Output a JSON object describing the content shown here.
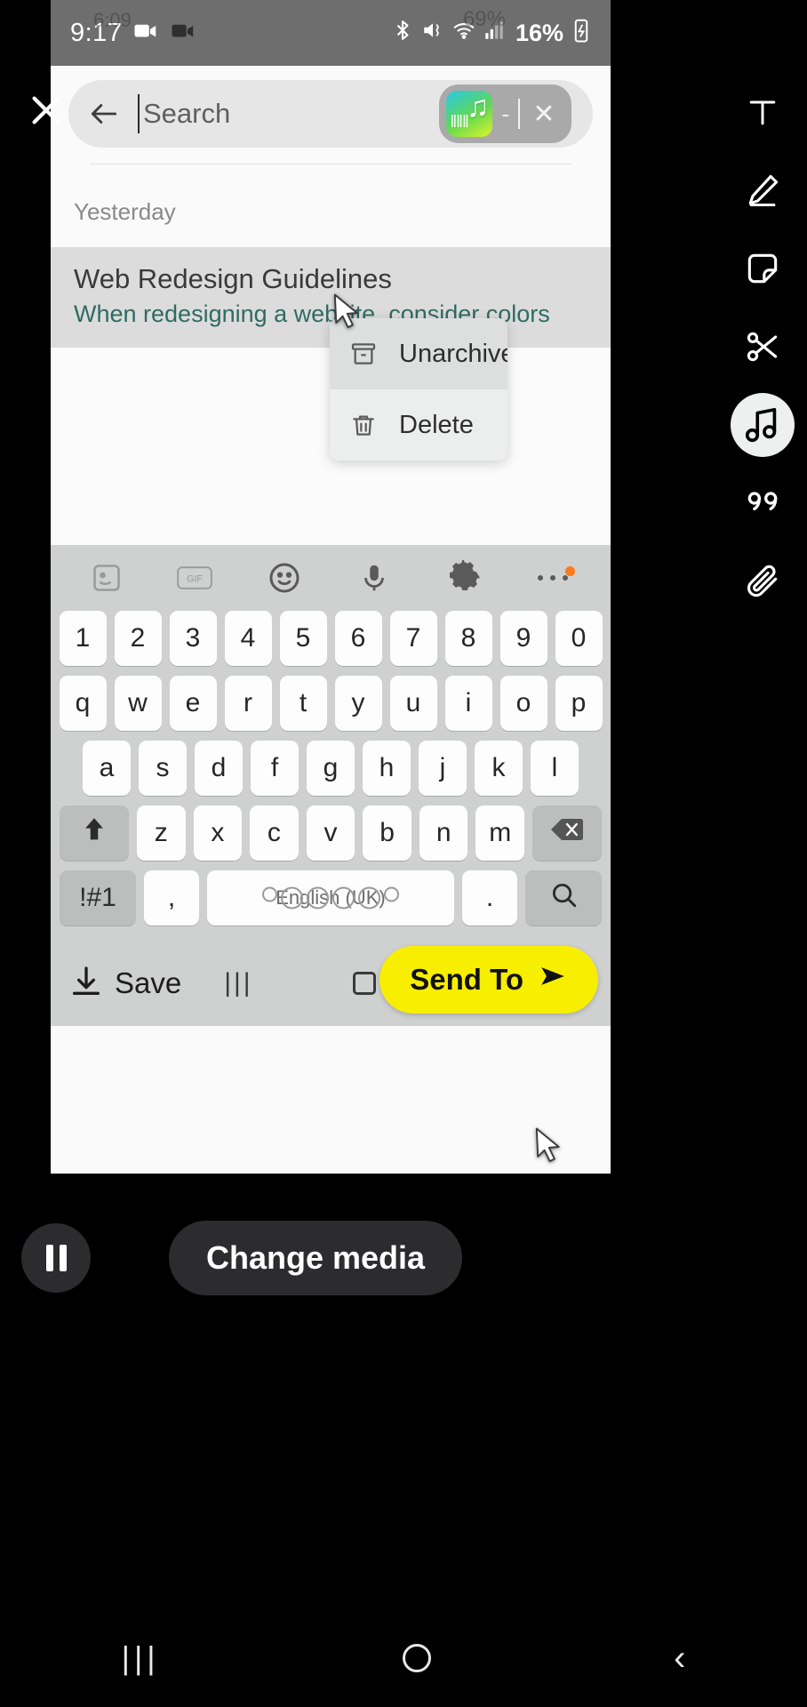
{
  "status_bar": {
    "time": "9:17",
    "left_icons": [
      "camera-icon",
      "video-camera-icon"
    ],
    "right_icons": [
      "bluetooth-icon",
      "mute-vibrate-icon",
      "wifi-icon",
      "cellular-signal-icon"
    ],
    "battery_percent": "16%",
    "battery_icon": "battery-charging-icon",
    "ghost_time": "6:09",
    "ghost_battery": "69%"
  },
  "search": {
    "back_icon": "back-arrow-icon",
    "placeholder": "Search",
    "value": "",
    "chip": {
      "app_icon": "music-app-icon",
      "note_glyph": "♫",
      "wave_glyph": "‖‖‖",
      "dash": "-",
      "close_icon": "close-icon"
    }
  },
  "list": {
    "section_label": "Yesterday",
    "items": [
      {
        "title": "Web Redesign Guidelines",
        "subtitle": "When redesigning a website, consider colors"
      }
    ]
  },
  "context_menu": {
    "items": [
      {
        "label": "Unarchive",
        "icon": "archive-box-icon",
        "highlighted": true
      },
      {
        "label": "Delete",
        "icon": "trash-icon",
        "highlighted": false
      }
    ]
  },
  "tool_rail": {
    "close_icon": "close-icon",
    "items": [
      {
        "name": "text-tool",
        "icon": "text-T-icon",
        "active": false
      },
      {
        "name": "draw-tool",
        "icon": "pen-icon",
        "active": false
      },
      {
        "name": "sticker-tool",
        "icon": "sticker-icon",
        "active": false
      },
      {
        "name": "trim-tool",
        "icon": "scissors-icon",
        "active": false
      },
      {
        "name": "music-tool",
        "icon": "music-note-icon",
        "active": true
      },
      {
        "name": "quote-tool",
        "icon": "quote-icon",
        "active": false
      },
      {
        "name": "attach-tool",
        "icon": "paperclip-icon",
        "active": false
      }
    ]
  },
  "keyboard": {
    "toolbar": [
      {
        "name": "sticker-suggest",
        "icon": "sticker-square-icon",
        "dim": true
      },
      {
        "name": "gif-key",
        "icon": "gif-icon",
        "dim": true
      },
      {
        "name": "emoji-key",
        "icon": "emoji-smiley-icon",
        "dim": false
      },
      {
        "name": "voice-key",
        "icon": "microphone-icon",
        "dim": false
      },
      {
        "name": "settings-key",
        "icon": "gear-icon",
        "dim": false
      },
      {
        "name": "more-key",
        "icon": "overflow-dots-icon",
        "dim": false,
        "badge": true
      }
    ],
    "row_numbers": [
      "1",
      "2",
      "3",
      "4",
      "5",
      "6",
      "7",
      "8",
      "9",
      "0"
    ],
    "row_top": [
      "q",
      "w",
      "e",
      "r",
      "t",
      "y",
      "u",
      "i",
      "o",
      "p"
    ],
    "row_home": [
      "a",
      "s",
      "d",
      "f",
      "g",
      "h",
      "j",
      "k",
      "l"
    ],
    "row_bottom": [
      "z",
      "x",
      "c",
      "v",
      "b",
      "n",
      "m"
    ],
    "shift_icon": "shift-up-arrow-icon",
    "backspace_icon": "backspace-icon",
    "symbols_key": "!#1",
    "comma_key": ",",
    "period_key": ".",
    "space_label": "English (UK)",
    "search_key_icon": "search-icon"
  },
  "app_bottom": {
    "save_label": "Save",
    "save_icon": "download-save-icon",
    "send_label": "Send To",
    "send_icon": "send-arrow-icon",
    "nav_recents_icon": "recents-bars-icon",
    "nav_home_icon": "home-square-icon"
  },
  "recording_controls": {
    "pause_icon": "pause-icon",
    "change_media_label": "Change media"
  },
  "system_nav": {
    "recents_icon": "recents-bars-icon",
    "home_icon": "home-circle-icon",
    "back_icon": "back-chevron-icon"
  },
  "colors": {
    "send_button": "#f7ee00",
    "subtitle_teal": "#2f6b62",
    "status_bar": "#6e6e6e",
    "keyboard_bg": "#cfd0d0",
    "selected_row": "#dcdcdc"
  }
}
